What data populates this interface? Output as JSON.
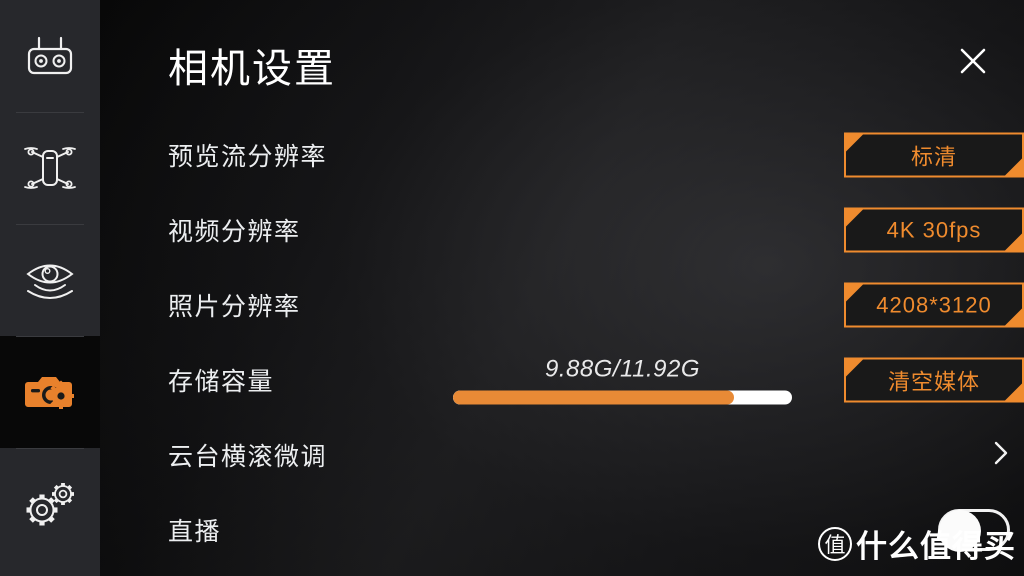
{
  "sidebar": {
    "items": [
      {
        "id": "remote-controller",
        "icon": "remote-controller-icon",
        "selected": false
      },
      {
        "id": "aircraft",
        "icon": "drone-icon",
        "selected": false
      },
      {
        "id": "vision-sensing",
        "icon": "eye-sensing-icon",
        "selected": false
      },
      {
        "id": "camera-settings",
        "icon": "camera-gear-icon",
        "selected": true
      },
      {
        "id": "general-settings",
        "icon": "gears-icon",
        "selected": false
      }
    ]
  },
  "header": {
    "title": "相机设置",
    "close_icon": "close-icon"
  },
  "settings": {
    "rows": [
      {
        "id": "preview-stream-resolution",
        "label": "预览流分辨率",
        "control": "button",
        "value": "标清"
      },
      {
        "id": "video-resolution",
        "label": "视频分辨率",
        "control": "button",
        "value": "4K 30fps"
      },
      {
        "id": "photo-resolution",
        "label": "照片分辨率",
        "control": "button",
        "value": "4208*3120"
      },
      {
        "id": "storage-capacity",
        "label": "存储容量",
        "control": "storage",
        "value": "清空媒体",
        "storage_text": "9.88G/11.92G",
        "used_gb": 9.88,
        "total_gb": 11.92,
        "used_percent": 82.9
      },
      {
        "id": "gimbal-roll-fine-tune",
        "label": "云台横滚微调",
        "control": "chevron",
        "value": ""
      },
      {
        "id": "live-streaming",
        "label": "直播",
        "control": "toggle",
        "value": "",
        "toggle_on": false
      }
    ]
  },
  "watermark": {
    "badge": "值",
    "text": "什么值得买"
  },
  "colors": {
    "accent": "#ef8b2e",
    "progress_fill": "#e88a36",
    "progress_track": "#ffffff",
    "sidebar_bg": "#27282c",
    "selected_bg": "#080808",
    "text_primary": "#eceef0"
  }
}
